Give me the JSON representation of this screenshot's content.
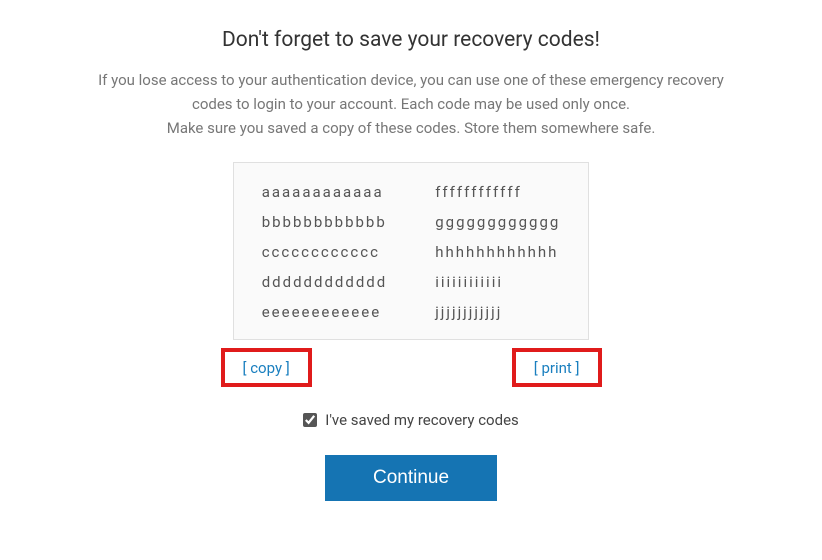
{
  "title": "Don't forget to save your recovery codes!",
  "description_line1": "If you lose access to your authentication device, you can use one of these emergency recovery",
  "description_line2": "codes to login to your account. Each code may be used only once.",
  "description_line3": "Make sure you saved a copy of these codes. Store them somewhere safe.",
  "codes": {
    "col1": [
      "aaaaaaaaaaaa",
      "bbbbbbbbbbbb",
      "cccccccccccc",
      "dddddddddddd",
      "eeeeeeeeeeee"
    ],
    "col2": [
      "ffffffffffff",
      "gggggggggggg",
      "hhhhhhhhhhhh",
      "iiiiiiiiiiii",
      "jjjjjjjjjjjj"
    ]
  },
  "actions": {
    "copy": "[ copy ]",
    "print": "[ print ]"
  },
  "confirm_label": "I've saved my recovery codes",
  "confirm_checked": true,
  "continue_label": "Continue"
}
